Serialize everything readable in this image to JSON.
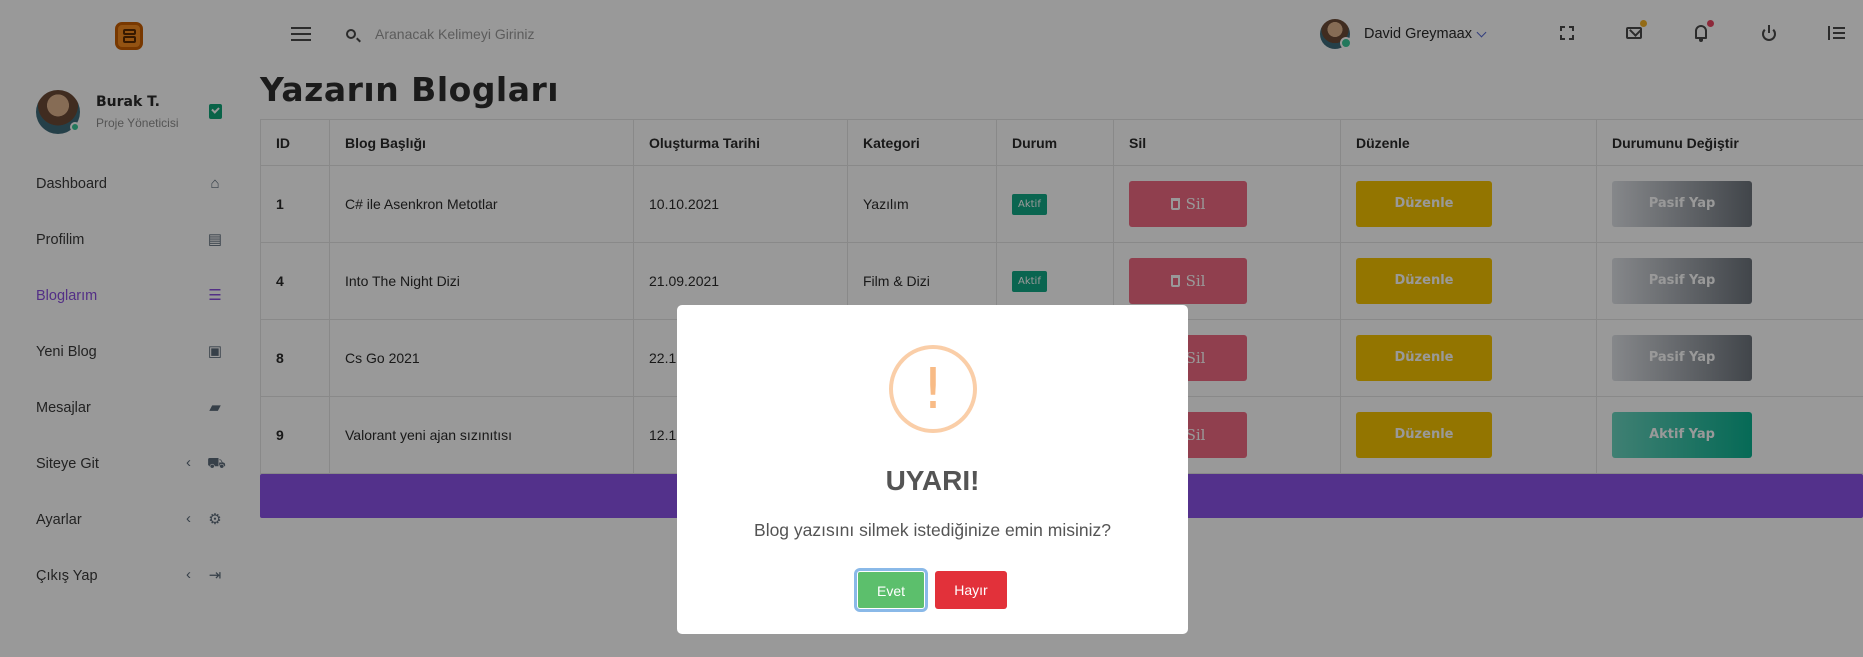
{
  "sidebar": {
    "profile": {
      "name": "Burak T.",
      "role": "Proje Yöneticisi"
    },
    "items": [
      {
        "label": "Dashboard",
        "icon": "home-icon"
      },
      {
        "label": "Profilim",
        "icon": "contact-card-icon"
      },
      {
        "label": "Bloglarım",
        "icon": "list-icon",
        "active": true
      },
      {
        "label": "Yeni Blog",
        "icon": "blogger-icon"
      },
      {
        "label": "Mesajlar",
        "icon": "chat-icon"
      },
      {
        "label": "Siteye Git",
        "icon": "car-icon",
        "expandable": true
      },
      {
        "label": "Ayarlar",
        "icon": "gear-icon",
        "expandable": true
      },
      {
        "label": "Çıkış Yap",
        "icon": "logout-icon",
        "expandable": true
      }
    ]
  },
  "topbar": {
    "search_placeholder": "Aranacak Kelimeyi Giriniz",
    "user_name": "David Greymaax"
  },
  "page": {
    "title": "Yazarın Blogları",
    "table": {
      "headers": [
        "ID",
        "Blog Başlığı",
        "Oluşturma Tarihi",
        "Kategori",
        "Durum",
        "Sil",
        "Düzenle",
        "Durumunu Değiştir"
      ],
      "rows": [
        {
          "id": "1",
          "title": "C# ile Asenkron Metotlar",
          "date": "10.10.2021",
          "category": "Yazılım",
          "status": "Aktif",
          "delete": "Sil",
          "edit": "Düzenle",
          "toggle": "Pasif Yap"
        },
        {
          "id": "4",
          "title": "Into The Night Dizi",
          "date": "21.09.2021",
          "category": "Film & Dizi",
          "status": "Aktif",
          "delete": "Sil",
          "edit": "Düzenle",
          "toggle": "Pasif Yap"
        },
        {
          "id": "8",
          "title": "Cs Go 2021",
          "date": "22.1",
          "category": "",
          "status": "",
          "delete": "Sil",
          "edit": "Düzenle",
          "toggle": "Pasif Yap"
        },
        {
          "id": "9",
          "title": "Valorant yeni ajan sızınıtısı",
          "date": "12.1",
          "category": "",
          "status": "",
          "delete": "Sil",
          "edit": "Düzenle",
          "toggle": "Aktif Yap"
        }
      ]
    }
  },
  "modal": {
    "icon": "!",
    "title": "UYARI!",
    "text": "Blog yazısını silmek istediğinize emin misiniz?",
    "confirm_label": "Evet",
    "cancel_label": "Hayır"
  },
  "colors": {
    "accent": "#8a52e8",
    "delete": "#f16a82",
    "edit": "#f5c400",
    "status_active": "#12a886",
    "confirm": "#5cbf6c",
    "cancel": "#e2313a"
  }
}
